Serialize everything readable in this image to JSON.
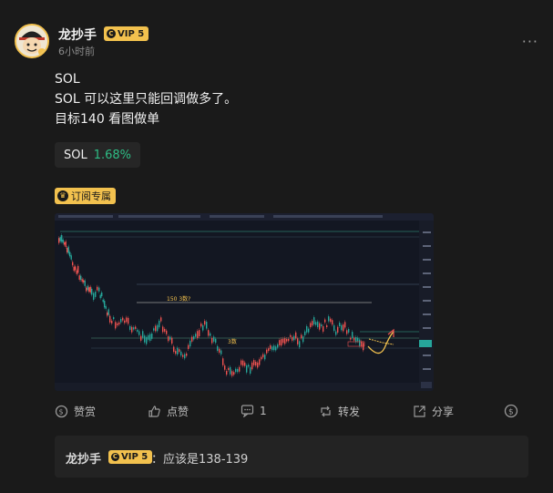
{
  "post": {
    "author": "龙抄手",
    "vip_badge": "VIP 5",
    "vip_icon": "C",
    "time": "6小时前",
    "more_icon": "···",
    "lines": [
      "SOL",
      "SOL 可以这里只能回调做多了。",
      "目标140  看图做单"
    ]
  },
  "coin": {
    "symbol": "SOL",
    "change": "1.68%",
    "change_color": "#2ebd85"
  },
  "subscribe_tag": {
    "label": "订阅专属",
    "icon": "crown-icon"
  },
  "chart": {
    "annotation_top": "150  3数?",
    "annotation_mid": "3数",
    "colors": {
      "up": "#26a69a",
      "down": "#ef5350",
      "accent": "#f2c14e"
    }
  },
  "actions": {
    "tip": "赞赏",
    "like": "点赞",
    "comment_count": "1",
    "share_repost": "转发",
    "share": "分享"
  },
  "comment": {
    "author": "龙抄手",
    "vip_badge": "VIP 5",
    "text": "：应该是138-139"
  }
}
